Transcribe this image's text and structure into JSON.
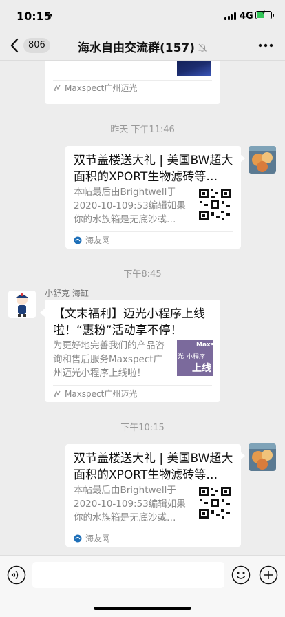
{
  "status_bar": {
    "time": "10:15",
    "location_arrow": "location-arrow-icon",
    "network": "4G",
    "battery": 0.55,
    "battery_color": "#34c759"
  },
  "nav": {
    "back_icon": "chevron-left-icon",
    "unread_count": "806",
    "title": "海水自由交流群(157)",
    "mute_icon": "bell-slash-icon",
    "more_icon": "ellipsis-icon"
  },
  "messages": [
    {
      "type": "link-card",
      "side": "left",
      "partial": true,
      "source": "Maxspect广州迈光"
    },
    {
      "type": "time",
      "text": "昨天 下午11:46"
    },
    {
      "type": "link-card",
      "side": "right",
      "title": "双节盖楼送大礼 | 美国BW超大面积的XPORT生物滤砖等…",
      "desc": "本帖最后由Brightwell于2020-10-109:53编辑如果你的水族箱是无底沙或…",
      "source": "海友网"
    },
    {
      "type": "time",
      "text": "下午8:45"
    },
    {
      "type": "link-card",
      "side": "left",
      "sender": "小舒克 海缸",
      "title": "【文末福利】迈光小程序上线啦！“惠粉”活动享不停！",
      "desc": "为更好地完善我们的产品咨询和售后服务Maxspect广州迈光小程序上线啦！",
      "thumb_text": [
        "Maxspe",
        "光",
        "小程序",
        "上线"
      ],
      "source": "Maxspect广州迈光"
    },
    {
      "type": "time",
      "text": "下午10:15"
    },
    {
      "type": "link-card",
      "side": "right",
      "title": "双节盖楼送大礼 | 美国BW超大面积的XPORT生物滤砖等…",
      "desc": "本帖最后由Brightwell于2020-10-109:53编辑如果你的水族箱是无底沙或…",
      "source": "海友网"
    }
  ],
  "input_bar": {
    "voice_icon": "voice-icon",
    "input_value": "",
    "emoji_icon": "emoji-icon",
    "plus_icon": "plus-circle-icon"
  },
  "colors": {
    "background": "#ededed",
    "card": "#ffffff",
    "muted_text": "#888888",
    "thumb_purple": "#7b6a9c"
  }
}
